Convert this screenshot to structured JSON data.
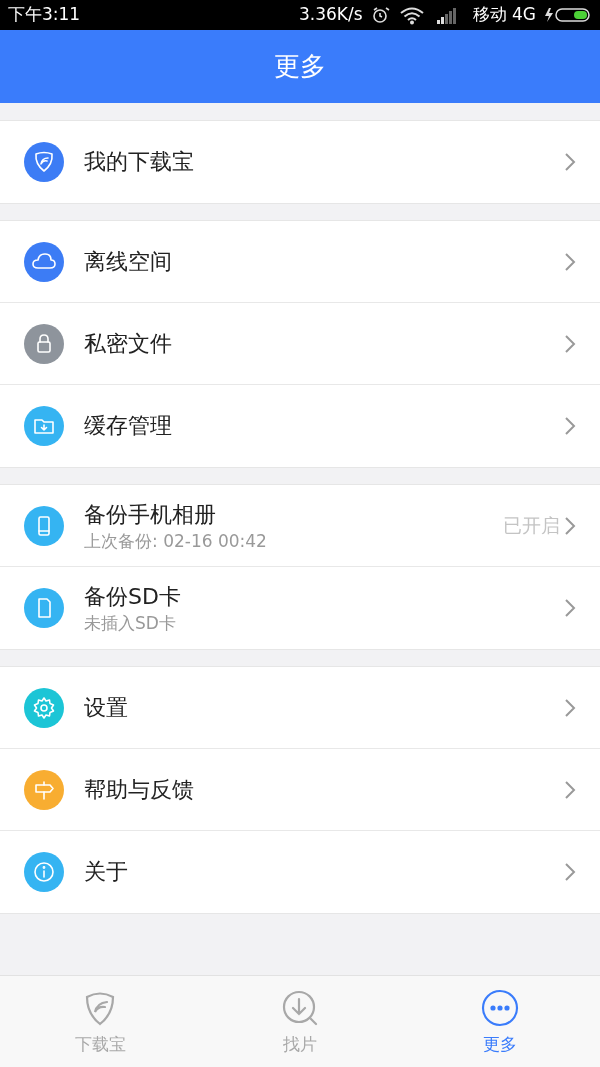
{
  "status_bar": {
    "time": "下午3:11",
    "speed": "3.36K/s",
    "carrier": "移动 4G"
  },
  "header": {
    "title": "更多"
  },
  "groups": [
    {
      "items": [
        {
          "kind": "shield",
          "color": "#3c7cf5",
          "label": "我的下载宝"
        }
      ]
    },
    {
      "items": [
        {
          "kind": "cloud",
          "color": "#3c7cf5",
          "label": "离线空间"
        },
        {
          "kind": "lock",
          "color": "#8e949c",
          "label": "私密文件"
        },
        {
          "kind": "folder",
          "color": "#35b4f2",
          "label": "缓存管理"
        }
      ]
    },
    {
      "items": [
        {
          "kind": "phone",
          "color": "#35b4f2",
          "label": "备份手机相册",
          "subtitle": "上次备份: 02-16 00:42",
          "value": "已开启"
        },
        {
          "kind": "sdcard",
          "color": "#35b4f2",
          "label": "备份SD卡",
          "subtitle": "未插入SD卡"
        }
      ]
    },
    {
      "items": [
        {
          "kind": "gear",
          "color": "#1cc5d6",
          "label": "设置"
        },
        {
          "kind": "sign",
          "color": "#f8ad31",
          "label": "帮助与反馈"
        },
        {
          "kind": "info",
          "color": "#35b4f2",
          "label": "关于"
        }
      ]
    }
  ],
  "tabs": [
    {
      "kind": "shield",
      "label": "下载宝",
      "selected": false
    },
    {
      "kind": "find",
      "label": "找片",
      "selected": false
    },
    {
      "kind": "more",
      "label": "更多",
      "selected": true
    }
  ]
}
